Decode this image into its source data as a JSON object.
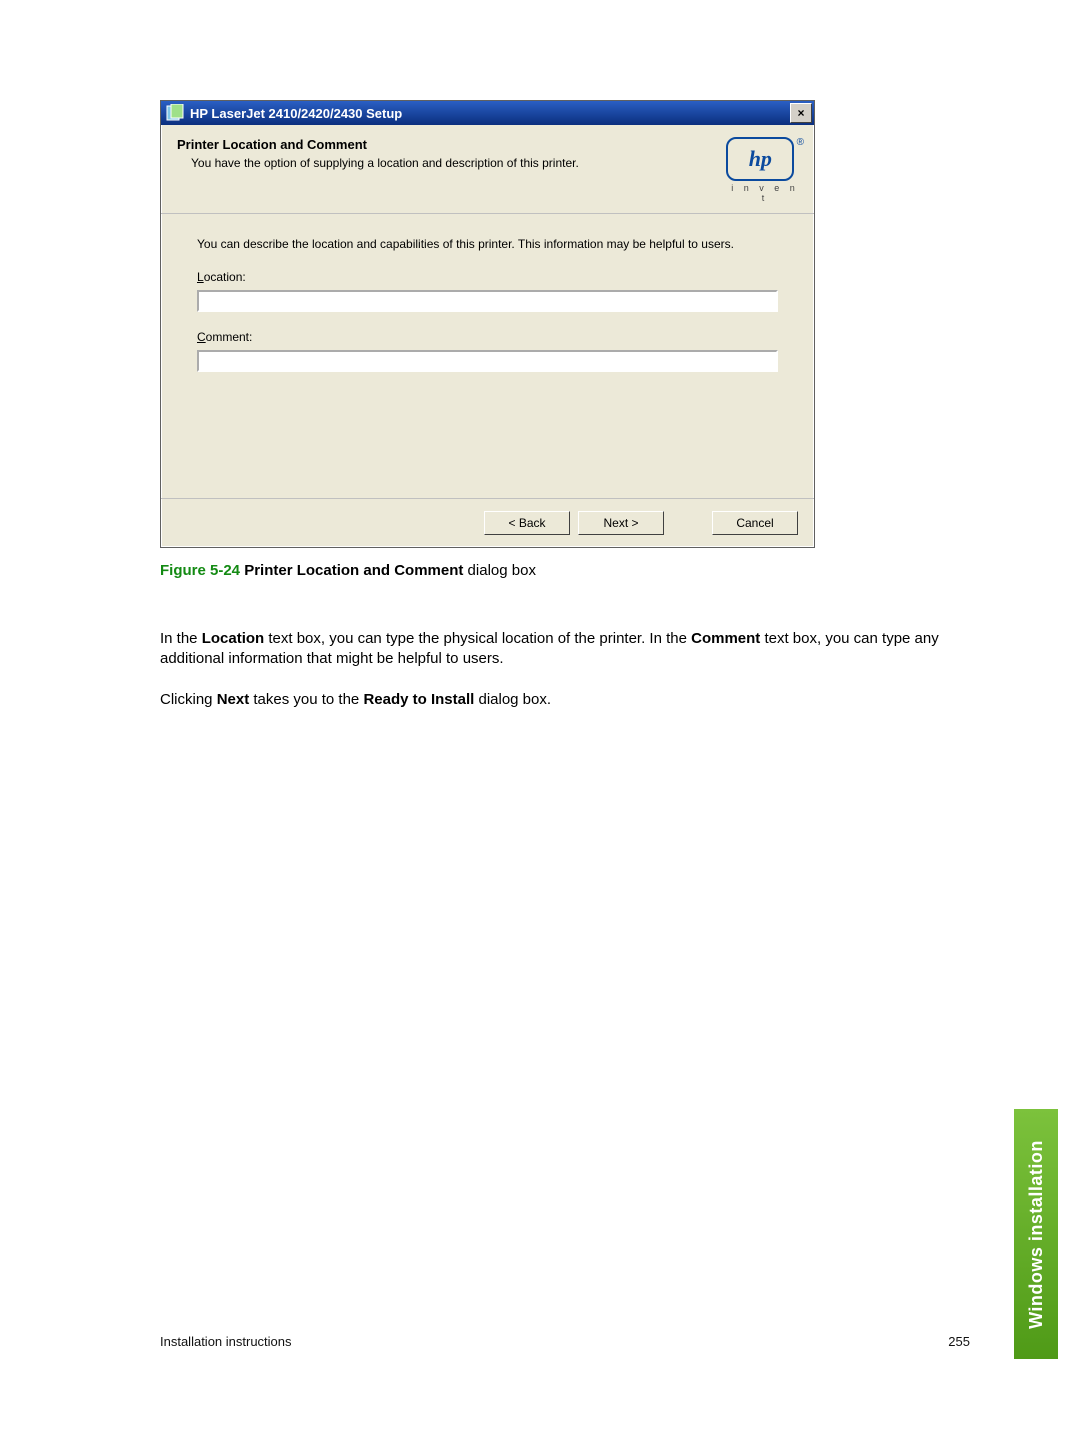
{
  "dialog": {
    "window_title": "HP LaserJet 2410/2420/2430 Setup",
    "close_label": "×",
    "header_title": "Printer Location and Comment",
    "header_sub": "You have the option of supplying a location and description of this printer.",
    "logo_text": "hp",
    "logo_tag": "i n v e n t",
    "registered": "®",
    "body_desc": "You can describe the location and capabilities of this printer.  This information may be helpful to users.",
    "location_underline": "L",
    "location_rest": "ocation:",
    "location_value": "",
    "comment_underline": "C",
    "comment_rest": "omment:",
    "comment_value": "",
    "back_label": "< Back",
    "next_label": "Next >",
    "cancel_label": "Cancel"
  },
  "figure": {
    "number": "Figure 5-24",
    "space": "   ",
    "title_bold": "Printer Location and Comment",
    "title_rest": " dialog box"
  },
  "para1": {
    "t1": "In the ",
    "b1": "Location",
    "t2": " text box, you can type the physical location of the printer. In the ",
    "b2": "Comment",
    "t3": " text box, you can type any additional information that might be helpful to users."
  },
  "para2": {
    "t1": "Clicking ",
    "b1": "Next",
    "t2": " takes you to the ",
    "b2": "Ready to Install",
    "t3": " dialog box."
  },
  "footer": {
    "left": "Installation instructions",
    "right": "255"
  },
  "sidetab": "Windows installation"
}
